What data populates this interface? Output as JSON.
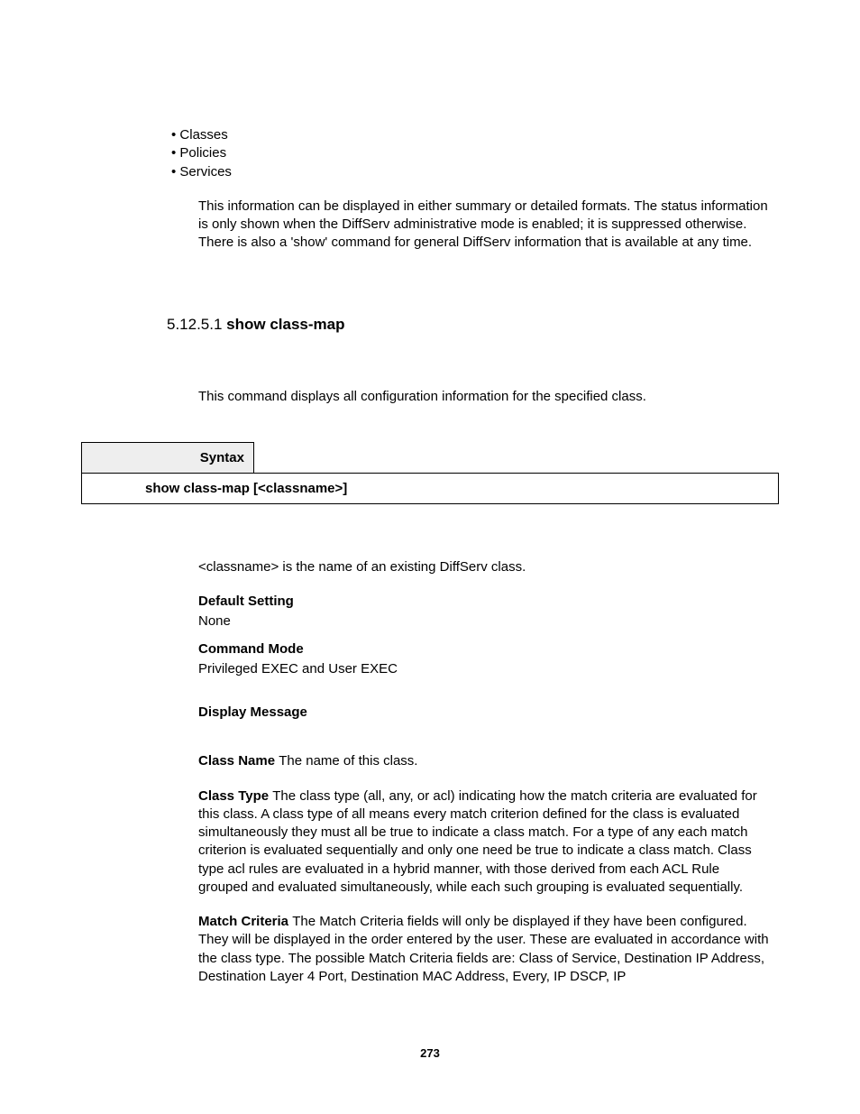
{
  "bullets": {
    "b1": "• Classes",
    "b2": "• Policies",
    "b3": "• Services"
  },
  "intro_para": "This information can be displayed in either summary or detailed formats. The status information is only shown when the DiffServ administrative mode is enabled; it is suppressed otherwise. There is also a 'show' command for general DiffServ information that is available at any time.",
  "section": {
    "num": "5.12.5.1 ",
    "title": "show class-map"
  },
  "section_intro": "This command displays all configuration information for the specified class.",
  "syntax": {
    "label": "Syntax",
    "command": "show class-map [<classname>]"
  },
  "classname_note": "<classname> is the name of an existing DiffServ class.",
  "default_setting": {
    "label": "Default Setting",
    "value": "None"
  },
  "command_mode": {
    "label": "Command Mode",
    "value": "Privileged EXEC and User EXEC"
  },
  "display_message": {
    "label": "Display Message"
  },
  "fields": {
    "class_name": {
      "label": "Class Name ",
      "text": "The name of this class."
    },
    "class_type": {
      "label": "Class Type ",
      "text": "The class type (all, any, or acl) indicating how the match criteria are evaluated for this class. A class type of all means every match criterion defined for the class is evaluated simultaneously they must all be true to indicate a class match. For a type of any each match criterion is evaluated sequentially and only one need be true to indicate a class match. Class type acl rules are evaluated in a hybrid manner, with those derived from each ACL Rule grouped and evaluated simultaneously, while each such grouping is evaluated sequentially."
    },
    "match_criteria": {
      "label": "Match Criteria ",
      "text": "The Match Criteria fields will only be displayed if they have been configured. They will be displayed in the order entered by the user. These are evaluated in accordance with the class type. The possible Match Criteria fields are: Class of Service, Destination IP Address, Destination Layer 4 Port, Destination MAC Address, Every, IP DSCP, IP"
    }
  },
  "page_number": "273"
}
